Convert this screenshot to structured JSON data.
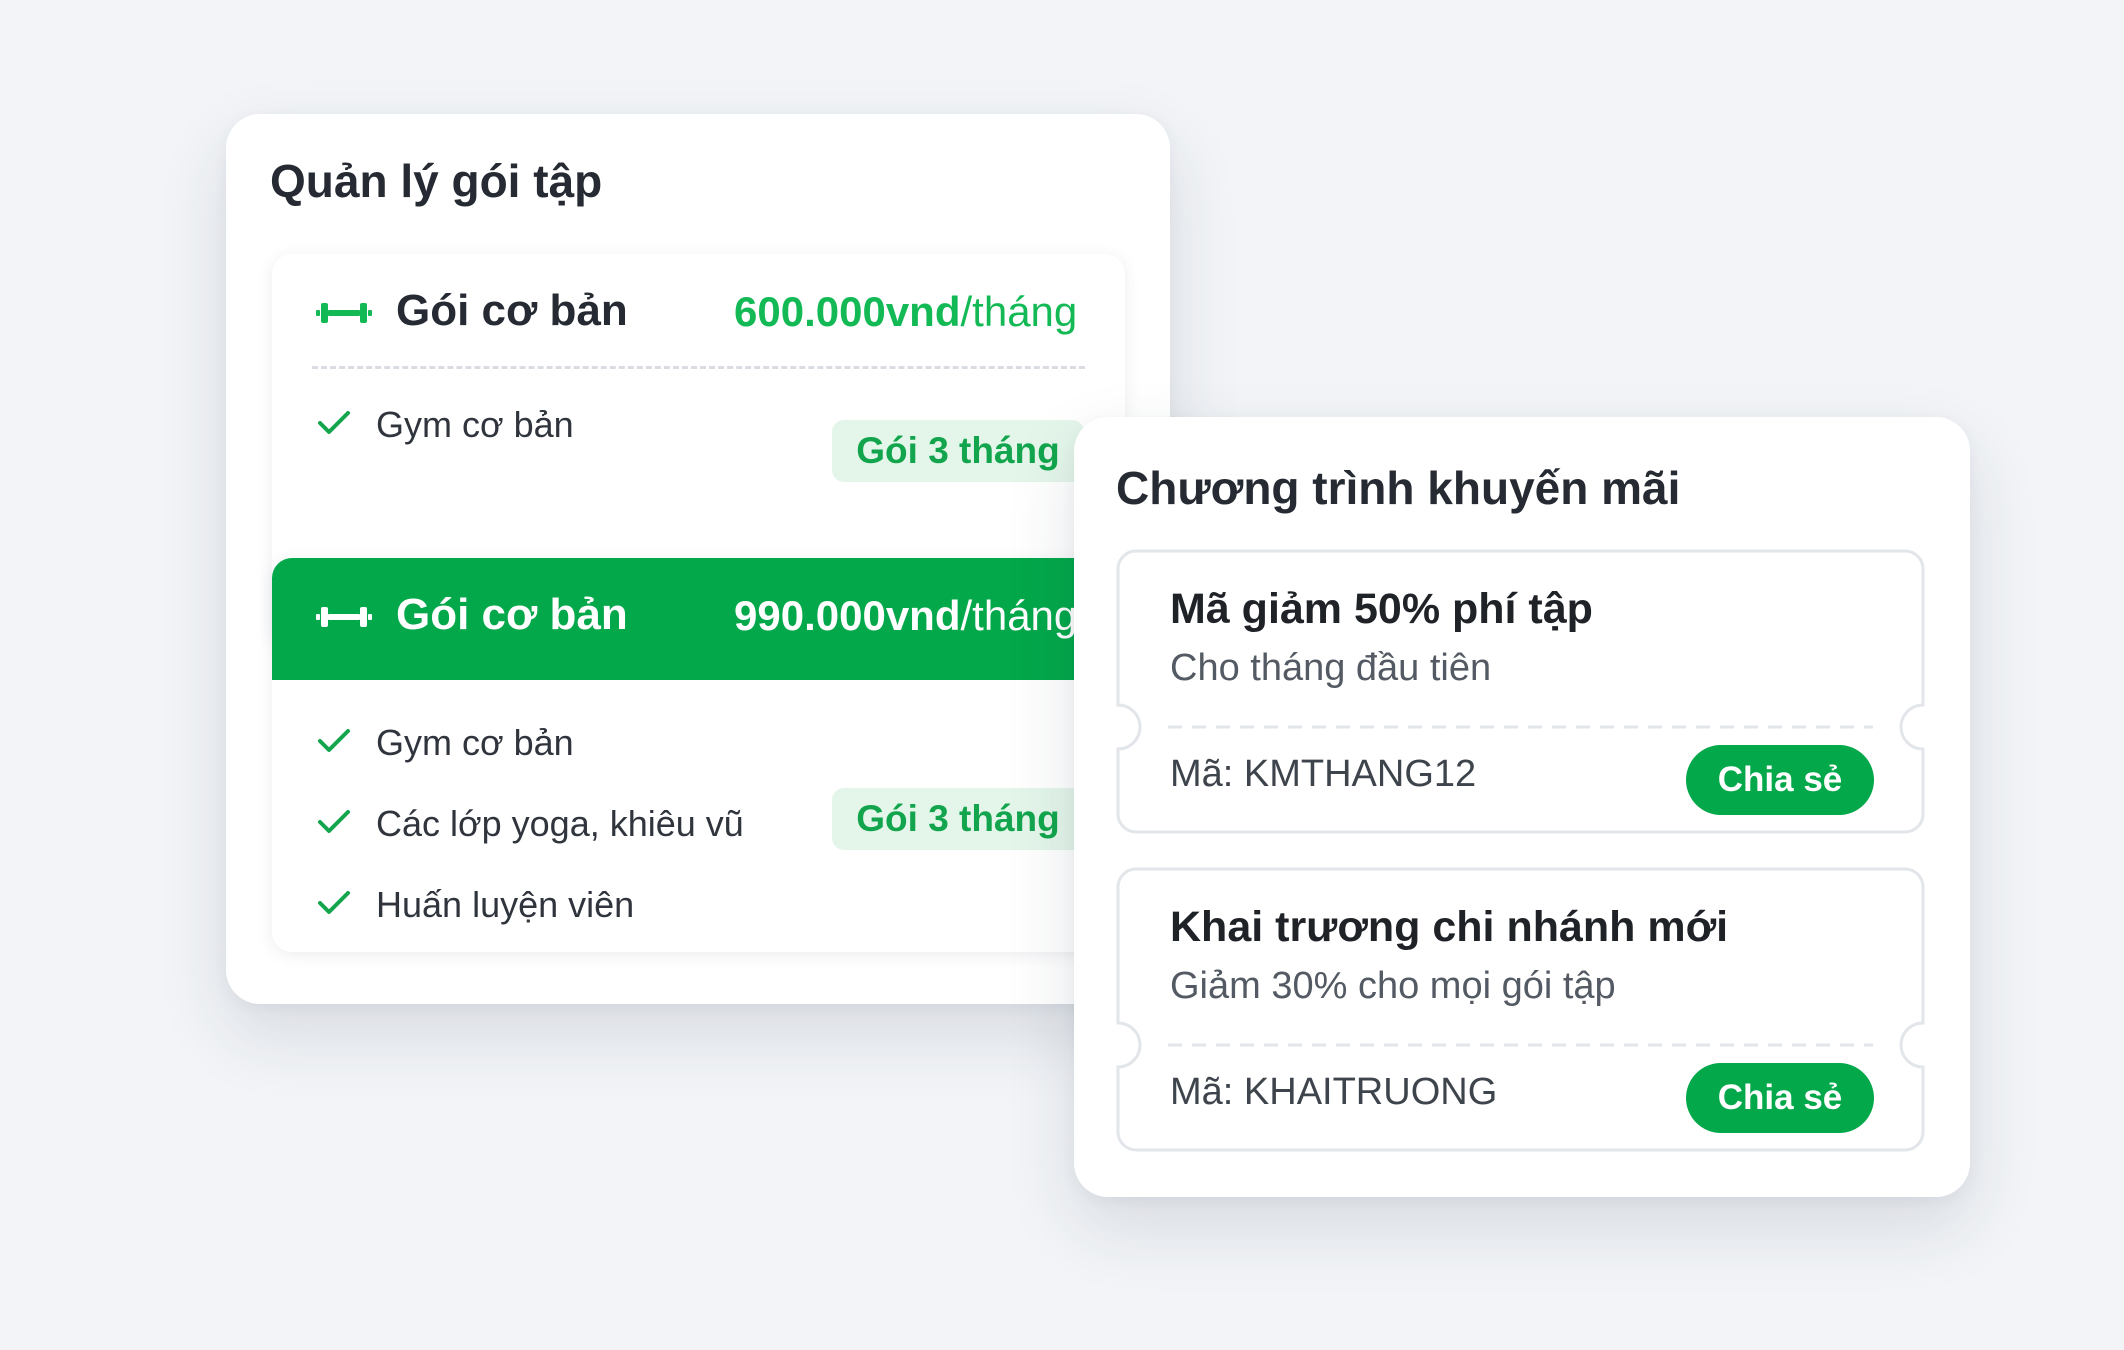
{
  "packages_card": {
    "title": "Quản lý gói tập",
    "packages": [
      {
        "name": "Gói cơ bản",
        "price": "600.000vnd",
        "unit": "/tháng",
        "badge": "Gói 3 tháng",
        "features": [
          "Gym cơ bản"
        ],
        "highlighted": false
      },
      {
        "name": "Gói cơ bản",
        "price": "990.000vnd",
        "unit": "/tháng",
        "badge": "Gói 3 tháng",
        "features": [
          "Gym cơ bản",
          "Các lớp yoga, khiêu vũ",
          "Huấn luyện viên"
        ],
        "highlighted": true
      }
    ]
  },
  "promo_card": {
    "title": "Chương trình khuyến mãi",
    "promos": [
      {
        "title": "Mã giảm 50% phí tập",
        "subtitle": "Cho tháng đầu tiên",
        "code": "Mã: KMTHANG12",
        "share_label": "Chia sẻ"
      },
      {
        "title": "Khai trương chi nhánh mới",
        "subtitle": "Giảm 30% cho mọi gói tập",
        "code": "Mã: KHAITRUONG",
        "share_label": "Chia sẻ"
      }
    ]
  },
  "icons": {
    "package": "dumbbell-icon",
    "feature": "check-icon"
  },
  "colors": {
    "accent": "#03a84a",
    "accent_text": "#12b955",
    "badge_bg": "#e4f6ea",
    "background": "#f2f4f7"
  }
}
